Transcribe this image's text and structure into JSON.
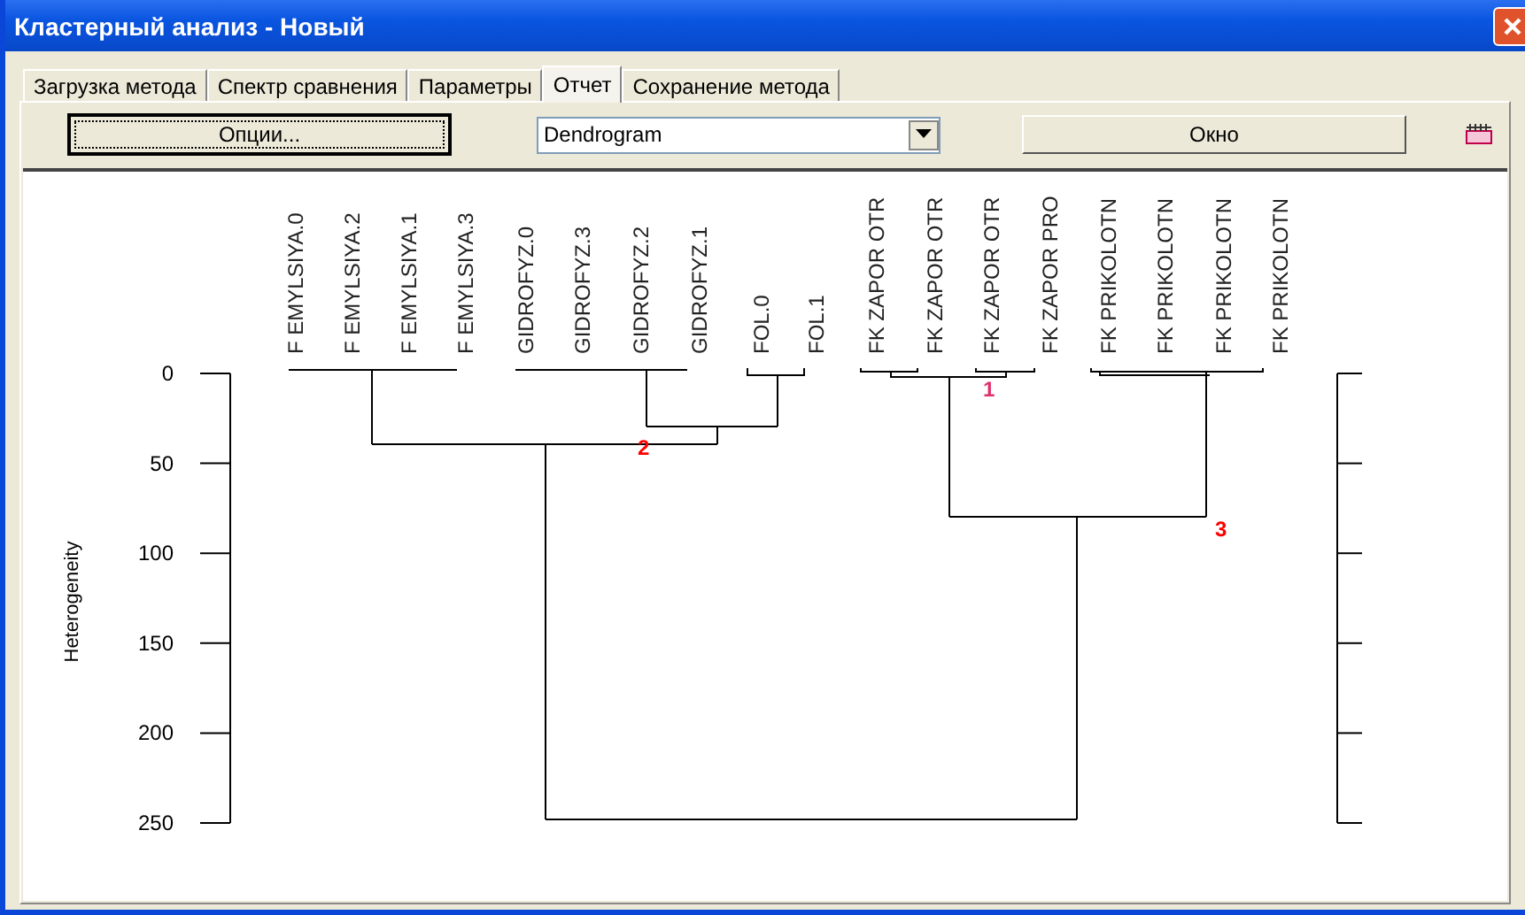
{
  "window": {
    "title": "Кластерный анализ  -  Новый"
  },
  "tabs": [
    {
      "label": "Загрузка метода",
      "selected": false
    },
    {
      "label": "Спектр сравнения",
      "selected": false
    },
    {
      "label": "Параметры",
      "selected": false
    },
    {
      "label": "Отчет",
      "selected": true
    },
    {
      "label": "Сохранение метода",
      "selected": false
    }
  ],
  "toolbar": {
    "options_button": "Опции...",
    "view_dropdown": "Dendrogram",
    "window_button": "Окно"
  },
  "dendrogram": {
    "ylabel": "Heterogeneity",
    "yticks": [
      "0",
      "50",
      "100",
      "150",
      "200",
      "250"
    ],
    "leaves": [
      "F EMYLSIYA.0",
      "F EMYLSIYA.2",
      "F EMYLSIYA.1",
      "F EMYLSIYA.3",
      "GIDROFYZ.0",
      "GIDROFYZ.3",
      "GIDROFYZ.2",
      "GIDROFYZ.1",
      "FOL.0",
      "FOL.1",
      "FK ZAPOR OTR",
      "FK ZAPOR OTR",
      "FK ZAPOR OTR",
      "FK ZAPOR PRO",
      "FK PRIKOLOTN",
      "FK PRIKOLOTN",
      "FK PRIKOLOTN",
      "FK PRIKOLOTN"
    ],
    "clusters": [
      {
        "label": "1",
        "color": "#e0306a"
      },
      {
        "label": "2",
        "color": "#ff0000"
      },
      {
        "label": "3",
        "color": "#ff0000"
      }
    ]
  }
}
